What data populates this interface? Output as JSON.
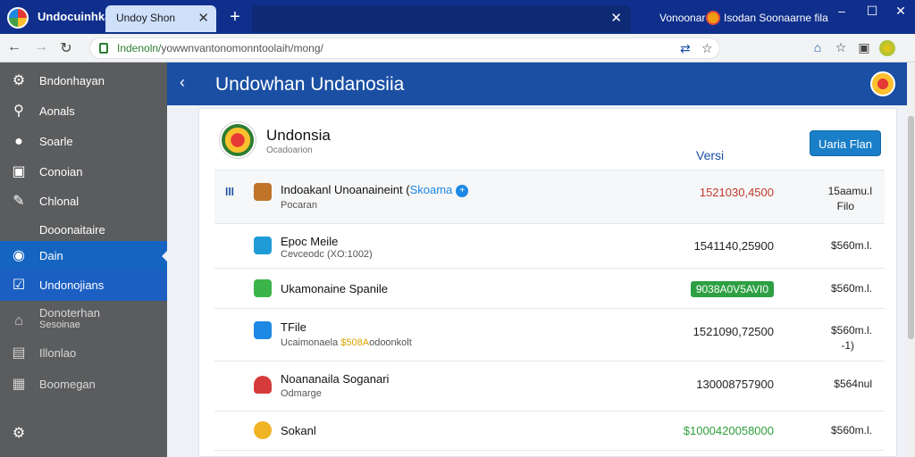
{
  "browser": {
    "app_name": "Undocuinhkan",
    "tab_active_label": "Undoy Shon",
    "tab_close_glyph": "✕",
    "new_tab_glyph": "+",
    "tab2_label": "Vonoonar",
    "tab3_label": "Isodan Soonaarne fila",
    "window_controls": [
      "–",
      "☐",
      "✕"
    ],
    "url_prefix": "Indenoln/",
    "url_rest": "yowwnvantonomonntoolaih/mong/"
  },
  "sidebar": {
    "items": [
      {
        "label": "Bndonhayan",
        "icon": "gear-icon",
        "glyph": "⚙"
      },
      {
        "label": "Aonals",
        "icon": "key-icon",
        "glyph": "⚲"
      },
      {
        "label": "Soarle",
        "icon": "chat-icon",
        "glyph": "●"
      },
      {
        "label": "Conoian",
        "icon": "box-icon",
        "glyph": "▣"
      },
      {
        "label": "Chlonal",
        "icon": "wrench-icon",
        "glyph": "✎"
      },
      {
        "label": "Dooonaitaire",
        "icon": "",
        "glyph": ""
      },
      {
        "label": "Dain",
        "icon": "dashboard-icon",
        "glyph": "◉"
      },
      {
        "label": "Undonojians",
        "icon": "monitor-icon",
        "glyph": "☑"
      },
      {
        "label": "Donoterhan",
        "sublabel": "Sesoinae",
        "icon": "home-icon",
        "glyph": "⌂"
      },
      {
        "label": "Illonlao",
        "icon": "lock-icon",
        "glyph": "▤"
      },
      {
        "label": "Boomegan",
        "icon": "document-icon",
        "glyph": "▦"
      },
      {
        "label": "",
        "icon": "settings-icon",
        "glyph": "⚙"
      }
    ]
  },
  "header": {
    "back_glyph": "‹",
    "title": "Undowhan Undanosiia"
  },
  "panel": {
    "org_name": "Undonsia",
    "org_sub": "Ocadoarion",
    "versi_label": "Versi",
    "primary_button": "Uaria Flan"
  },
  "rows": [
    {
      "title": "Indoakanl Unoanaineint",
      "tag": "Skoama",
      "sub": "Pocaran",
      "value": "1521030,4500",
      "size": "15aamu.l",
      "size2": "Filo",
      "icon_color": "#c0742a",
      "icon": "image-icon"
    },
    {
      "title": "Epoc Meile",
      "sub": "Cevceodc (XO:1002)",
      "value": "1541140,25900",
      "size": "$560m.l.",
      "icon_color": "#1e9bd7",
      "icon": "file-icon"
    },
    {
      "title": "Ukamonaine Spanile",
      "sub": "",
      "value": "9038A0V5AVI0",
      "size": "$560m.l.",
      "icon_color": "#3bb54a",
      "icon": "sheet-icon"
    },
    {
      "title": "TFile",
      "sub_prefix": "Ucaimonaela ",
      "sub_hl": "$508A",
      "sub_suffix": "odoonkolt",
      "value": "1521090,72500",
      "size": "$560m.l.",
      "size2": "-1)",
      "icon_color": "#1e88e5",
      "icon": "puzzle-icon"
    },
    {
      "title": "Noananaila Soganari",
      "sub": "Odmarge",
      "value": "130008757900",
      "size": "$564nul",
      "icon_color": "#d63b3b",
      "icon": "shield-icon"
    },
    {
      "title": "Sokanl",
      "sub": "",
      "value": "$1000420058000",
      "size": "$560m.l.",
      "icon_color": "#f0b323",
      "icon": "coin-icon"
    }
  ],
  "colors": {
    "brand_blue": "#1a4fa3",
    "tabstrip": "#102f8c",
    "sidebar": "#5b5c5e",
    "active": "#1565c0",
    "green": "#2ea043",
    "red": "#c0392b"
  }
}
